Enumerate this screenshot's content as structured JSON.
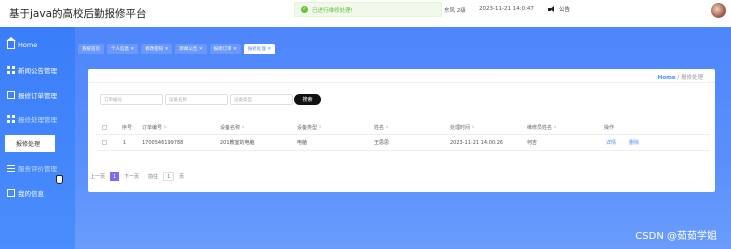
{
  "header": {
    "title": "基于java的高校后勤报修平台",
    "toast": "已进行维修处理!",
    "weather": "东风 2级",
    "datetime": "2023-11-21 14:0:47",
    "notice_label": "公告"
  },
  "sidebar": {
    "items": [
      {
        "label": "Home",
        "icon": "home-icon"
      },
      {
        "label": "新闻公告管理",
        "icon": "grid-icon"
      },
      {
        "label": "报修订单管理",
        "icon": "document-icon"
      },
      {
        "label": "报修处理管理",
        "icon": "grid-icon"
      },
      {
        "label": "报修处理",
        "icon": ""
      },
      {
        "label": "服务评价管理",
        "icon": "menu-icon"
      },
      {
        "label": "我的信息",
        "icon": "document-icon"
      }
    ]
  },
  "tabs": [
    {
      "label": "系统首页",
      "active": false
    },
    {
      "label": "个人信息 ✕",
      "active": false
    },
    {
      "label": "修改密码 ✕",
      "active": false
    },
    {
      "label": "新闻公告 ✕",
      "active": false
    },
    {
      "label": "报修订单 ✕",
      "active": false
    },
    {
      "label": "报修处理 ✕",
      "active": true
    }
  ],
  "breadcrumb": {
    "home": "Home",
    "sep": "/",
    "current": "报修处理"
  },
  "search": {
    "order_no_placeholder": "订单编号",
    "equipment_placeholder": "设备名称",
    "type_placeholder": "设备类型",
    "button": "搜索"
  },
  "table": {
    "columns": [
      "序号",
      "订单编号",
      "设备名称",
      "设备类型",
      "姓名",
      "处理时间",
      "维修员姓名",
      "操作"
    ],
    "rows": [
      {
        "index": "1",
        "order_no": "1700546199788",
        "equipment": "201教室的电脑",
        "type": "电脑",
        "name": "王思思",
        "time": "2023-11-21 14:00:26",
        "repairer": "何吉",
        "actions": [
          "详情",
          "删除"
        ]
      }
    ]
  },
  "pagination": {
    "prev": "上一页",
    "current": "1",
    "next": "下一页",
    "goto_label": "前往",
    "goto_value": "1",
    "page_suffix": "页"
  },
  "watermark": "CSDN @茹茹学姐",
  "colors": {
    "primary": "#4a8dfc",
    "sidebar": "#3a7dfa",
    "active_page": "#7b6cf0",
    "toast_text": "#67c23a"
  }
}
